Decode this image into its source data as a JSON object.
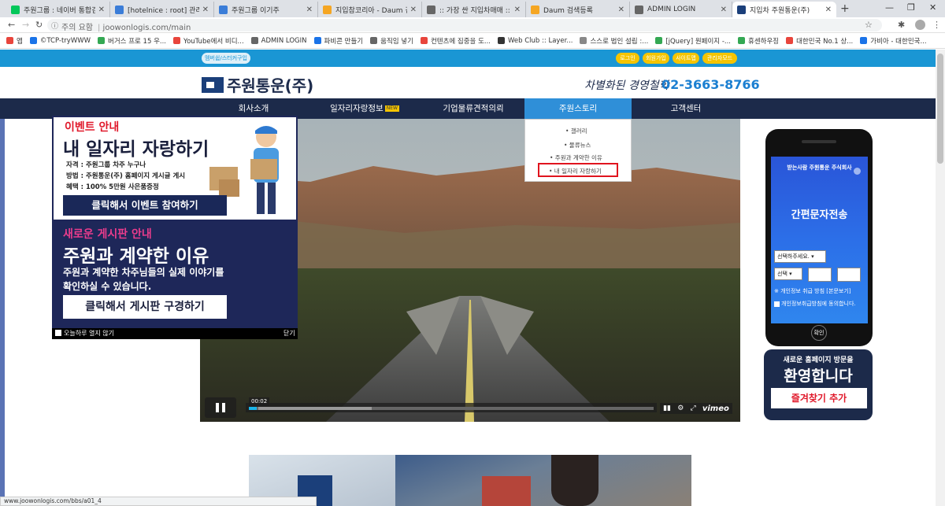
{
  "tabs": [
    {
      "title": "주원그룹 : 네이버 통합검색",
      "color": "#03c75a"
    },
    {
      "title": "[hotelnice : root] 관리자 페",
      "color": "#3b7dd8"
    },
    {
      "title": "주원그룹 이기주",
      "color": "#3b7dd8"
    },
    {
      "title": "지입참코리아 - Daum 검색",
      "color": "#f5a623"
    },
    {
      "title": ":: 가장 싼 지입차매매 :: 지입",
      "color": "#666666"
    },
    {
      "title": "Daum 검색등록",
      "color": "#f5a623"
    },
    {
      "title": "ADMIN LOGIN",
      "color": "#666666"
    },
    {
      "title": "지입차 주원통운(주)",
      "color": "#1b3f7a"
    }
  ],
  "browser": {
    "security": "주의 요함",
    "url": "joowonlogis.com/main",
    "new_tab": "+"
  },
  "bookmarks": [
    {
      "label": "앱",
      "color": "#e8453c"
    },
    {
      "label": "©TCP-tryWWW",
      "color": "#1a73e8"
    },
    {
      "label": "버거스 프로 15 우...",
      "color": "#34a853"
    },
    {
      "label": "YouTube에서 비디...",
      "color": "#e8453c"
    },
    {
      "label": "ADMIN LOGIN",
      "color": "#666666"
    },
    {
      "label": "파비콘 만들기",
      "color": "#1a73e8"
    },
    {
      "label": "움직임 넣기",
      "color": "#666666"
    },
    {
      "label": "컨텐츠에 집중을 도...",
      "color": "#e8453c"
    },
    {
      "label": "Web Club :: Layer...",
      "color": "#333333"
    },
    {
      "label": "스스로 법인 설립 :...",
      "color": "#888888"
    },
    {
      "label": "[jQuery] 원페이지 -...",
      "color": "#34a853"
    },
    {
      "label": "휴센하우징",
      "color": "#34a853"
    },
    {
      "label": "대한민국 No.1 상...",
      "color": "#e8453c"
    },
    {
      "label": "가비아 - 대한민국...",
      "color": "#1a73e8"
    }
  ],
  "site": {
    "top_left_pill": "멤버쉽/스터커구입",
    "top_pills": [
      "로그인",
      "회원가입",
      "사이트맵",
      "관리자모드"
    ],
    "logo": "주원통운(주)",
    "slogan": "차별화된 경영철학",
    "phone": "02-3663-8766",
    "nav": [
      "회사소개",
      "일자리자랑정보",
      "기업물류견적의뢰",
      "주원스토리",
      "고객센터"
    ],
    "nav_new": "NEW",
    "dropdown": [
      "• 갤러리",
      "• 물류뉴스",
      "• 주원과 계약한 이유",
      "• 내 일자리 자랑하기"
    ]
  },
  "popup": {
    "ev_title1": "이벤트 안내",
    "ev_title2": "내 일자리 자랑하기",
    "ev_lines": [
      "자격 : 주원그룹 차주 누구나",
      "방법 : 주원통운(주) 홈페이지 게시글 게시",
      "혜택 : 100% 5만원 사은품증정"
    ],
    "ev_button": "클릭해서 이벤트 참여하기",
    "bd_title1": "새로운 게시판 안내",
    "bd_title2": "주원과 계약한 이유",
    "bd_lines": [
      "주원과 계약한 차주님들의 실제 이야기를",
      "확인하실 수 있습니다."
    ],
    "bd_button": "클릭해서 게시판 구경하기",
    "foot_left": "오늘하루 열지 않기",
    "foot_right": "닫기"
  },
  "video": {
    "time": "00:02",
    "progress": 0.02,
    "brand": "vimeo"
  },
  "widget": {
    "header": "받는사람   주원통운 주식회사",
    "title": "간편문자전송",
    "select1": "선택하주세요.",
    "select2": "선택",
    "privacy": "※ 개인정보 취급 방침 [본문보기]",
    "agree": "개인정보취급방침에 동의합니다.",
    "confirm": "확인",
    "welcome1": "새로운 홈페이지 방문을",
    "welcome2": "환영합니다",
    "welcome_btn": "즐겨찾기 추가"
  },
  "status_url": "www.joowonlogis.com/bbs/a01_4"
}
